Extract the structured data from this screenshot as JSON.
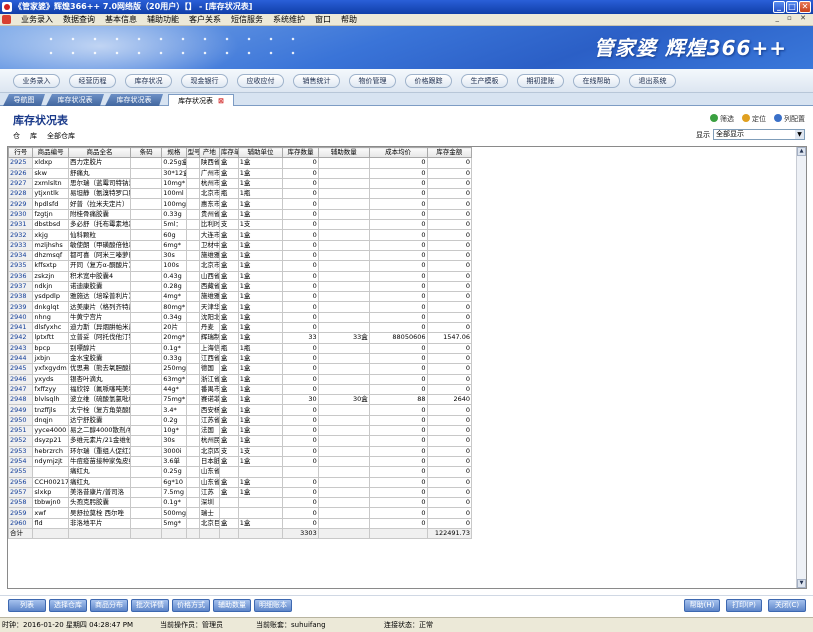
{
  "window": {
    "title": "《管家婆》辉煌366++ 7.0网络版（20用户）【】 - [库存状况表]"
  },
  "menu": [
    "业务录入",
    "数据查询",
    "基本信息",
    "辅助功能",
    "客户关系",
    "短信服务",
    "系统维护",
    "窗口",
    "帮助"
  ],
  "banner": {
    "brand": "管家婆 辉煌366++"
  },
  "nav": [
    "业务录入",
    "经营历程",
    "库存状况",
    "现金银行",
    "应收应付",
    "销售统计",
    "物价管理",
    "价格跟踪",
    "生产模板",
    "期初建账",
    "在线帮助",
    "退出系统"
  ],
  "tabs": [
    "导航图",
    "库存状况表",
    "库存状况表",
    "库存状况表"
  ],
  "page": {
    "title": "库存状况表",
    "tools": [
      "筛选",
      "定位",
      "列配置"
    ],
    "filter_prefix": "仓",
    "filter_label": "库",
    "filter_value": "全部仓库",
    "display_label": "显示",
    "display_value": "全部显示"
  },
  "table": {
    "headers": [
      "行号",
      "商品编号",
      "商品全名",
      "条码",
      "规格",
      "型号",
      "产地",
      "库存单位",
      "辅助单位",
      "库存数量",
      "辅助数量",
      "成本均价",
      "库存金额"
    ],
    "rows": [
      [
        "2925",
        "xldxp",
        "西力定胶片",
        "",
        "0.25g盒",
        "",
        "陕西省",
        "盒",
        "1盒",
        "0",
        "",
        "0",
        "0"
      ],
      [
        "2926",
        "skw",
        "舒痛丸",
        "",
        "30*12盒",
        "",
        "广州市",
        "盒",
        "1盒",
        "0",
        "",
        "0",
        "0"
      ],
      [
        "2927",
        "zxmlsltn",
        "思尔瑞（蓝霉司特钠泡腾",
        "",
        "10mg*",
        "",
        "杭州市",
        "盒",
        "1盒",
        "0",
        "",
        "0",
        "0"
      ],
      [
        "2928",
        "ytjxntlk",
        "易坦静（氨溴特罗口服",
        "",
        "100ml",
        "",
        "北京市",
        "瓶",
        "1瓶",
        "0",
        "",
        "0",
        "0"
      ],
      [
        "2929",
        "hpdlsfd",
        "好普（拉米夫定片）",
        "",
        "100mg",
        "",
        "惠东市",
        "盒",
        "1盒",
        "0",
        "",
        "0",
        "0"
      ],
      [
        "2930",
        "fzgtjn",
        "附桂骨痛胶囊",
        "",
        "0.33g",
        "",
        "贵州省",
        "盒",
        "1盒",
        "0",
        "",
        "0",
        "0"
      ],
      [
        "2931",
        "dbstbsd",
        "多必舒（托布霉素地塞",
        "",
        "5ml：",
        "",
        "比利时",
        "支",
        "1支",
        "0",
        "",
        "0",
        "0"
      ],
      [
        "2932",
        "xkjg",
        "仙科颗粒",
        "",
        "60g",
        "",
        "大连市",
        "盒",
        "1盒",
        "0",
        "",
        "0",
        "0"
      ],
      [
        "2933",
        "mzljhshs",
        "敏使朗（甲磺酸倍他司",
        "",
        "6mg*",
        "",
        "卫材中",
        "盒",
        "1盒",
        "0",
        "",
        "0",
        "0"
      ],
      [
        "2934",
        "dhzmsqf",
        "都可喜（阿米三嗪萝巴",
        "",
        "30s",
        "",
        "施维雅",
        "盒",
        "1盒",
        "0",
        "",
        "0",
        "0"
      ],
      [
        "2935",
        "kffsxtp",
        "开同（复方α-酮酸片）",
        "",
        "100s",
        "",
        "北京市",
        "盒",
        "1盒",
        "0",
        "",
        "0",
        "0"
      ],
      [
        "2936",
        "zskzjn",
        "积术宽中胶囊4",
        "",
        "0.43g",
        "",
        "山西省",
        "盒",
        "1盒",
        "0",
        "",
        "0",
        "0"
      ],
      [
        "2937",
        "ndkjn",
        "诺迪康胶囊",
        "",
        "0.28g",
        "",
        "西藏省",
        "盒",
        "1盒",
        "0",
        "",
        "0",
        "0"
      ],
      [
        "2938",
        "ysdpdlp",
        "雅施达（培哚普利片）",
        "",
        "4mg*",
        "",
        "施维雅",
        "盒",
        "1盒",
        "0",
        "",
        "0",
        "0"
      ],
      [
        "2939",
        "dnkglqt",
        "达美康片（格列齐特片",
        "",
        "80mg*",
        "",
        "天津华",
        "盒",
        "1盒",
        "0",
        "",
        "0",
        "0"
      ],
      [
        "2940",
        "nhng",
        "牛黄宁宫片",
        "",
        "0.34g",
        "",
        "沈阳北",
        "盒",
        "1盒",
        "0",
        "",
        "0",
        "0"
      ],
      [
        "2941",
        "dlsfyxhc",
        "迪力斯（异烟肼帕米片",
        "",
        "20片",
        "",
        "丹麦",
        "盒",
        "1盒",
        "0",
        "",
        "0",
        "0"
      ],
      [
        "2942",
        "lptxftt",
        "立普妥（阿托伐他汀钙",
        "",
        "20mg*",
        "",
        "辉瑞制",
        "盒",
        "1盒",
        "33",
        "33盒",
        "88050606",
        "1547.06"
      ],
      [
        "2943",
        "bpcp",
        "别嘌醇片",
        "",
        "0.1g*",
        "",
        "上海信",
        "瓶",
        "1瓶",
        "0",
        "",
        "0",
        "0"
      ],
      [
        "2944",
        "jxbjn",
        "金水宝胶囊",
        "",
        "0.33g",
        "",
        "江西省",
        "盒",
        "1盒",
        "0",
        "",
        "0",
        "0"
      ],
      [
        "2945",
        "yxfxgydm",
        "优思弗（熊去氧胆酸胶",
        "",
        "250mg",
        "",
        "德国",
        "盒",
        "1盒",
        "0",
        "",
        "0",
        "0"
      ],
      [
        "2946",
        "yxyds",
        "银杏叶滴丸",
        "",
        "63mg*",
        "",
        "浙江省",
        "盒",
        "1盒",
        "0",
        "",
        "0",
        "0"
      ],
      [
        "2947",
        "fxffzyy",
        "福欣锌（氟哌噻吨美利",
        "",
        "44g*",
        "",
        "番禺市",
        "盒",
        "1盒",
        "0",
        "",
        "0",
        "0"
      ],
      [
        "2948",
        "blvlsqlh",
        "波立维（硫酸氢氯吡格",
        "",
        "75mg*",
        "",
        "赛诺菲",
        "盒",
        "1盒",
        "30",
        "30盒",
        "88",
        "2640"
      ],
      [
        "2949",
        "tnzffjls",
        "太宁栓（复方角菜酸酯",
        "",
        "3.4*",
        "",
        "西安杨",
        "盒",
        "1盒",
        "0",
        "",
        "0",
        "0"
      ],
      [
        "2950",
        "dnqjn",
        "达宁舒胶囊",
        "",
        "0.2g",
        "",
        "江苏省",
        "盒",
        "1盒",
        "0",
        "",
        "0",
        "0"
      ],
      [
        "2951",
        "yyce4000",
        "易之二醇4000散剂/福松",
        "",
        "10g*",
        "",
        "法国",
        "盒",
        "1盒",
        "0",
        "",
        "0",
        "0"
      ],
      [
        "2952",
        "dsyzp21",
        "多维元素片/21金维他片",
        "",
        "30s",
        "",
        "杭州民",
        "盒",
        "1盒",
        "0",
        "",
        "0",
        "0"
      ],
      [
        "2953",
        "hebrzrch",
        "环尔瑞（重组人促红素",
        "",
        "3000i",
        "",
        "北京四",
        "支",
        "1支",
        "0",
        "",
        "0",
        "0"
      ],
      [
        "2954",
        "ndymjzjt",
        "牛痘疫苗接种家兔皮组",
        "",
        "3.6单",
        "",
        "日本脏",
        "盒",
        "1盒",
        "0",
        "",
        "0",
        "0"
      ],
      [
        "2955",
        "",
        "痛红丸",
        "",
        "0.25g",
        "",
        "山东省",
        "",
        "",
        "",
        "",
        "0",
        "0"
      ],
      [
        "2956",
        "CCH00217",
        "痛红丸",
        "",
        "6g*10",
        "",
        "山东省",
        "盒",
        "1盒",
        "0",
        "",
        "0",
        "0"
      ],
      [
        "2957",
        "slxkp",
        "美洛昔康片/普司洛",
        "",
        "7.5mg",
        "",
        "江苏",
        "盒",
        "1盒",
        "0",
        "",
        "0",
        "0"
      ],
      [
        "2958",
        "tbbwjn0",
        "头孢克肟胶囊",
        "",
        "0.1g*",
        "",
        "深圳",
        "",
        "",
        "0",
        "",
        "0",
        "0"
      ],
      [
        "2959",
        "xwf",
        "吴舒拉莫栓 西尔唑",
        "",
        "500mg",
        "",
        "瑞士",
        "",
        "",
        "0",
        "",
        "0",
        "0"
      ],
      [
        "2960",
        "fld",
        "非洛地平片",
        "",
        "5mg*",
        "",
        "北京巨",
        "盒",
        "1盒",
        "0",
        "",
        "0",
        "0"
      ]
    ],
    "total": {
      "label": "合计",
      "qty": "3303",
      "amount": "122491.73"
    }
  },
  "buttons_left": [
    "列表",
    "选择仓库",
    "商品分布",
    "批次详情",
    "价格方式",
    "辅助数量",
    "明细账本"
  ],
  "buttons_right": [
    "帮助(H)",
    "打印(P)",
    "关闭(C)"
  ],
  "status": {
    "time": "时钟：2016-01-20 星期四 04:28:47 PM",
    "operator": "当前操作员：管理员",
    "account": "当前账套：suhuifang",
    "connection": "连接状态：正常"
  }
}
